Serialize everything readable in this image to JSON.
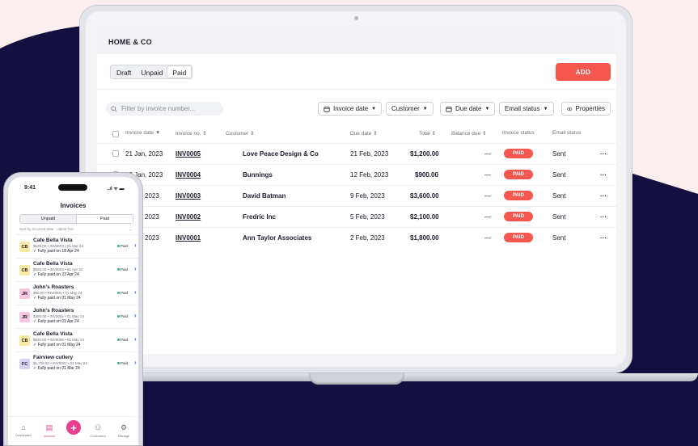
{
  "colors": {
    "accent": "#f3574e",
    "navy": "#130f3e",
    "pink": "#e83e8c",
    "paid_dot": "#2eb872"
  },
  "desktop": {
    "brand": "HOME & CO",
    "tabs": [
      "Draft",
      "Unpaid",
      "Paid"
    ],
    "active_tab": "Paid",
    "add_label": "ADD",
    "search_placeholder": "Filter by invoice number...",
    "filters": {
      "invoice_date": "Invoice date",
      "customer": "Customer",
      "due_date": "Due date",
      "email_status": "Email status",
      "properties": "Properties"
    },
    "columns": {
      "invoice_date": "Invoice date",
      "invoice_no": "Invoice no.",
      "customer": "Customer",
      "due_date": "Due date",
      "total": "Total",
      "balance_due": "Balance due",
      "invoice_status": "Invoice status",
      "email_status": "Email status"
    },
    "rows": [
      {
        "date": "21 Jan, 2023",
        "no": "INV0005",
        "customer": "Love Peace Design & Co",
        "due": "21 Feb, 2023",
        "total": "$1,200.00",
        "balance": "—",
        "status": "PAID",
        "email": "Sent",
        "more": "···"
      },
      {
        "date": "12 Jan, 2023",
        "no": "INV0004",
        "customer": "Bunnings",
        "due": "12 Feb, 2023",
        "total": "$900.00",
        "balance": "—",
        "status": "PAID",
        "email": "Sent",
        "more": "···"
      },
      {
        "date": "9 Jan, 2023",
        "no": "INV0003",
        "customer": "David Batman",
        "due": "9 Feb, 2023",
        "total": "$3,600.00",
        "balance": "—",
        "status": "PAID",
        "email": "Sent",
        "more": "···"
      },
      {
        "date": "5 Jan, 2023",
        "no": "INV0002",
        "customer": "Fredric Inc",
        "due": "5 Feb, 2023",
        "total": "$2,100.00",
        "balance": "—",
        "status": "PAID",
        "email": "Sent",
        "more": "···"
      },
      {
        "date": "2 Jan, 2023",
        "no": "INV0001",
        "customer": "Ann Taylor Associates",
        "due": "2 Feb, 2023",
        "total": "$1,800.00",
        "balance": "—",
        "status": "PAID",
        "email": "Sent",
        "more": "···"
      }
    ]
  },
  "mobile": {
    "time": "9:41",
    "signal": "..ıl ᯤ ▬",
    "title": "Invoices",
    "segments": [
      "Unpaid",
      "Paid"
    ],
    "sort_label": "Sort by Invoiced date - oldest first",
    "items": [
      {
        "initials": "CB",
        "name": "Cafe Bella Vista",
        "meta": "$525.00 • INV0003 • 01 Mar 24",
        "paid_on": "✓ Fully paid on 18 Apr 24",
        "status": "Paid",
        "avatar_color": "#fbe9a6"
      },
      {
        "initials": "CB",
        "name": "Cafe Bella Vista",
        "meta": "$525.00 • INV0004 • 01 Apr 24",
        "paid_on": "✓ Fully paid on 23 Apr 24",
        "status": "Paid",
        "avatar_color": "#fbe9a6"
      },
      {
        "initials": "JR",
        "name": "John's Roasters",
        "meta": "$50.00 • INV0001 • 01 May 24",
        "paid_on": "✓ Fully paid on 01 May 24",
        "status": "Paid",
        "avatar_color": "#f7c6e0"
      },
      {
        "initials": "JR",
        "name": "John's Roasters",
        "meta": "$390.00 • INV0002 • 01 May 24",
        "paid_on": "✓ Fully paid on 01 Apr 24",
        "status": "Paid",
        "avatar_color": "#f7c6e0"
      },
      {
        "initials": "CB",
        "name": "Cafe Bella Vista",
        "meta": "$630.00 • INV0006 • 01 May 24",
        "paid_on": "✓ Fully paid on 01 May 24",
        "status": "Paid",
        "avatar_color": "#fbe9a6"
      },
      {
        "initials": "FC",
        "name": "Fairview cutlery",
        "meta": "$1,709.50 • INV0007 • 01 May 24",
        "paid_on": "✓ Fully paid on 01 Mar 24",
        "status": "Paid",
        "avatar_color": "#d9d2f5"
      }
    ],
    "nav": {
      "dashboard": "Dashboard",
      "invoices": "Invoices",
      "customers": "Customers",
      "manage": "Manage"
    }
  }
}
